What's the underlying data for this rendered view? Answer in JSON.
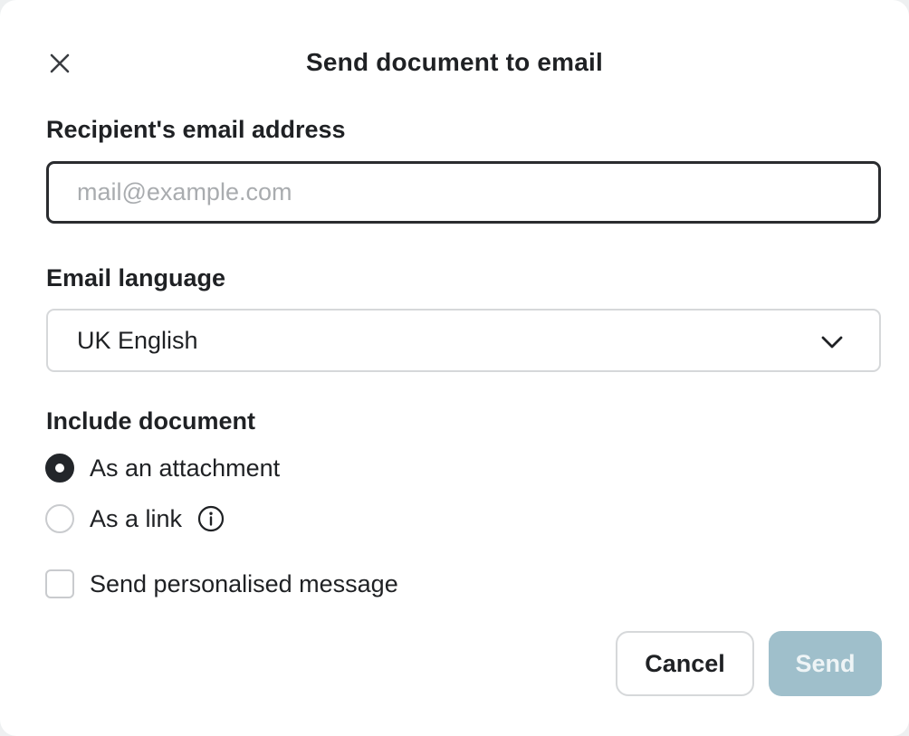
{
  "dialog": {
    "title": "Send document to email",
    "close_icon": "close-icon"
  },
  "recipient": {
    "label": "Recipient's email address",
    "value": "",
    "placeholder": "mail@example.com"
  },
  "language": {
    "label": "Email language",
    "selected": "UK English",
    "icon": "chevron-down-icon"
  },
  "include_document": {
    "label": "Include document",
    "options": [
      {
        "label": "As an attachment",
        "checked": true
      },
      {
        "label": "As a link",
        "checked": false,
        "icon": "info-icon"
      }
    ]
  },
  "personalised_message": {
    "label": "Send personalised message",
    "checked": false
  },
  "actions": {
    "cancel_label": "Cancel",
    "send_label": "Send",
    "send_enabled": false
  },
  "colors": {
    "send_disabled_bg": "#9fbfcb",
    "text": "#1f2124",
    "placeholder": "#a9acaf",
    "border": "#d6d8da"
  }
}
